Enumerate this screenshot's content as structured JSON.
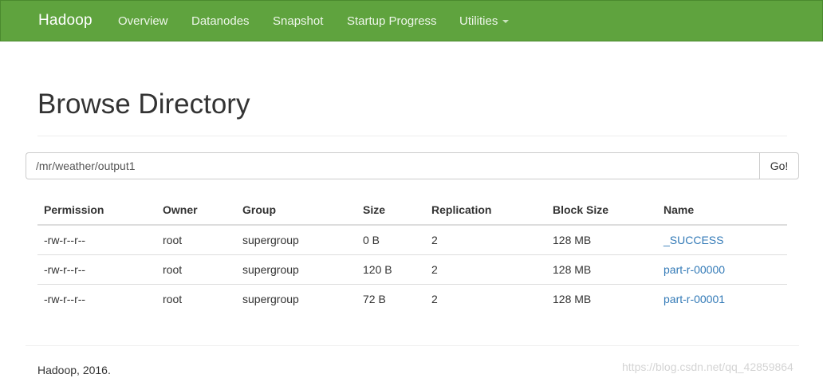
{
  "navbar": {
    "brand": "Hadoop",
    "items": [
      {
        "label": "Overview"
      },
      {
        "label": "Datanodes"
      },
      {
        "label": "Snapshot"
      },
      {
        "label": "Startup Progress"
      },
      {
        "label": "Utilities"
      }
    ],
    "color": "#5fa33e"
  },
  "page": {
    "title": "Browse Directory"
  },
  "path_bar": {
    "value": "/mr/weather/output1",
    "go_label": "Go!"
  },
  "table": {
    "headers": [
      "Permission",
      "Owner",
      "Group",
      "Size",
      "Replication",
      "Block Size",
      "Name"
    ],
    "rows": [
      {
        "permission": "-rw-r--r--",
        "owner": "root",
        "group": "supergroup",
        "size": "0 B",
        "replication": "2",
        "block_size": "128 MB",
        "name": "_SUCCESS"
      },
      {
        "permission": "-rw-r--r--",
        "owner": "root",
        "group": "supergroup",
        "size": "120 B",
        "replication": "2",
        "block_size": "128 MB",
        "name": "part-r-00000"
      },
      {
        "permission": "-rw-r--r--",
        "owner": "root",
        "group": "supergroup",
        "size": "72 B",
        "replication": "2",
        "block_size": "128 MB",
        "name": "part-r-00001"
      }
    ],
    "link_color": "#337ab7"
  },
  "footer": {
    "text": "Hadoop, 2016."
  },
  "watermark": "https://blog.csdn.net/qq_42859864"
}
